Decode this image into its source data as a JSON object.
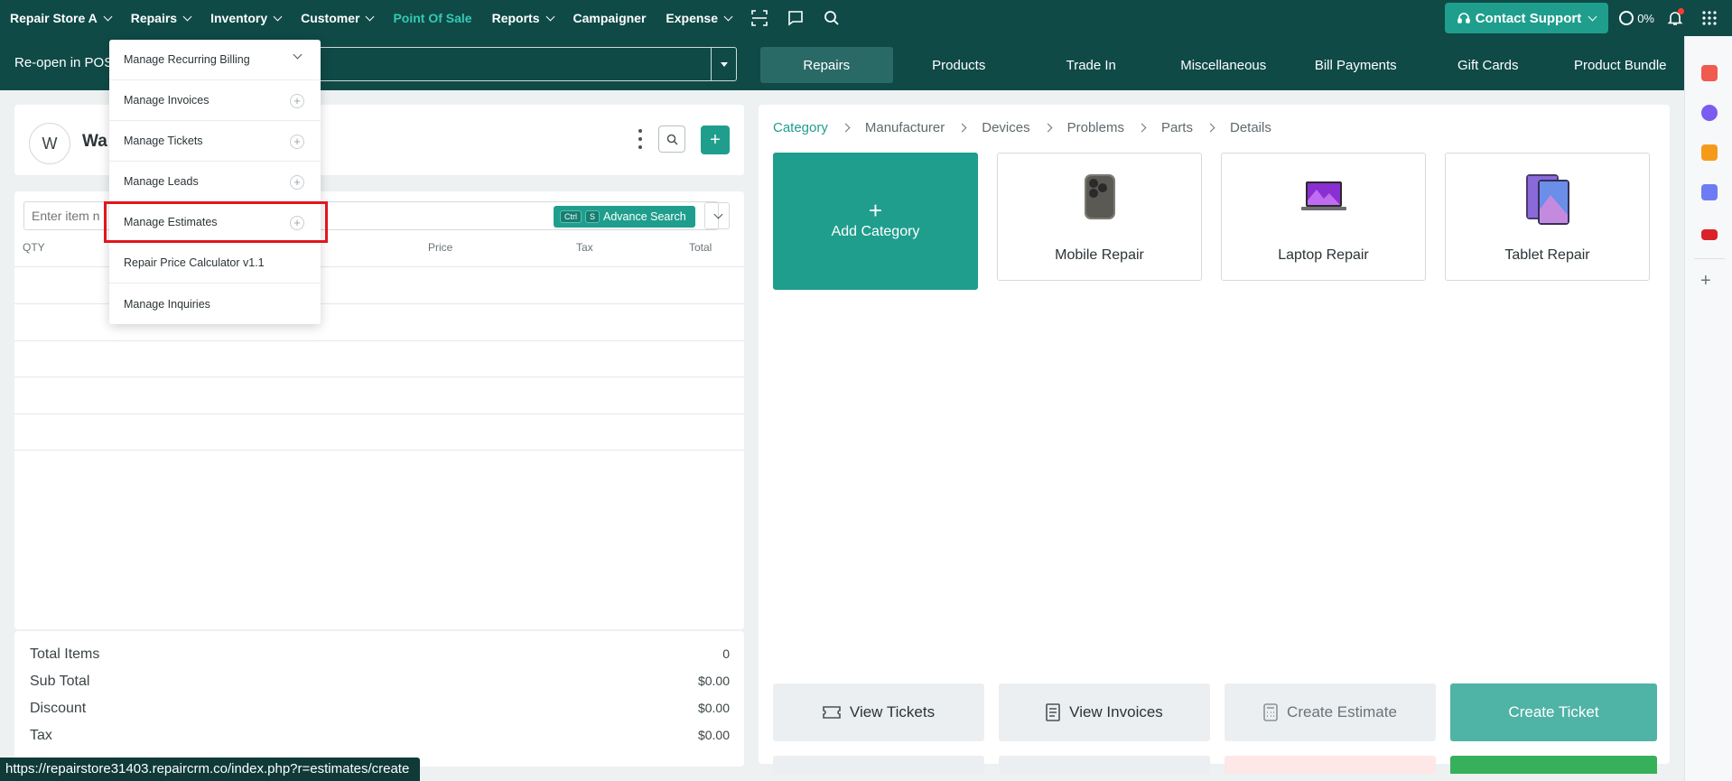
{
  "topnav": {
    "items": [
      {
        "label": "Repair Store A",
        "chevron": true
      },
      {
        "label": "Repairs",
        "chevron": true
      },
      {
        "label": "Inventory",
        "chevron": true
      },
      {
        "label": "Customer",
        "chevron": true
      },
      {
        "label": "Point Of Sale",
        "chevron": false,
        "active": true
      },
      {
        "label": "Reports",
        "chevron": true
      },
      {
        "label": "Campaigner",
        "chevron": false
      },
      {
        "label": "Expense",
        "chevron": true
      }
    ],
    "contact_support": "Contact Support",
    "progress_label": "0%"
  },
  "subbar": {
    "reopen_label": "Re-open in POS",
    "tabs": [
      "Repairs",
      "Products",
      "Trade In",
      "Miscellaneous",
      "Bill Payments",
      "Gift Cards",
      "Product Bundle"
    ]
  },
  "customer": {
    "avatar_initial": "W",
    "name": "Wa"
  },
  "items": {
    "input_placeholder": "Enter item n",
    "advance_search": "Advance Search",
    "kbd_ctrl": "Ctrl",
    "kbd_s": "S",
    "columns": [
      "QTY",
      "Price",
      "Tax",
      "Total"
    ]
  },
  "totals": {
    "rows": [
      {
        "label": "Total Items",
        "value": "0"
      },
      {
        "label": "Sub Total",
        "value": "$0.00"
      },
      {
        "label": "Discount",
        "value": "$0.00"
      },
      {
        "label": "Tax",
        "value": "$0.00"
      }
    ]
  },
  "catalog": {
    "breadcrumbs": [
      "Category",
      "Manufacturer",
      "Devices",
      "Problems",
      "Parts",
      "Details"
    ],
    "add_category": "Add Category",
    "cards": [
      "Mobile Repair",
      "Laptop Repair",
      "Tablet Repair"
    ],
    "actions": {
      "view_tickets": "View Tickets",
      "view_invoices": "View Invoices",
      "create_estimate": "Create Estimate",
      "create_ticket": "Create Ticket"
    }
  },
  "dropdown": {
    "items": [
      "Manage Recurring Billing",
      "Manage Invoices",
      "Manage Tickets",
      "Manage Leads",
      "Manage Estimates",
      "Repair Price Calculator v1.1",
      "Manage Inquiries"
    ]
  },
  "status_url": "https://repairstore31403.repaircrm.co/index.php?r=estimates/create",
  "colors": {
    "header_bg": "#0f4a47",
    "accent": "#1f9e8d",
    "active_nav": "#35c9b3",
    "highlight": "#e1161d"
  }
}
